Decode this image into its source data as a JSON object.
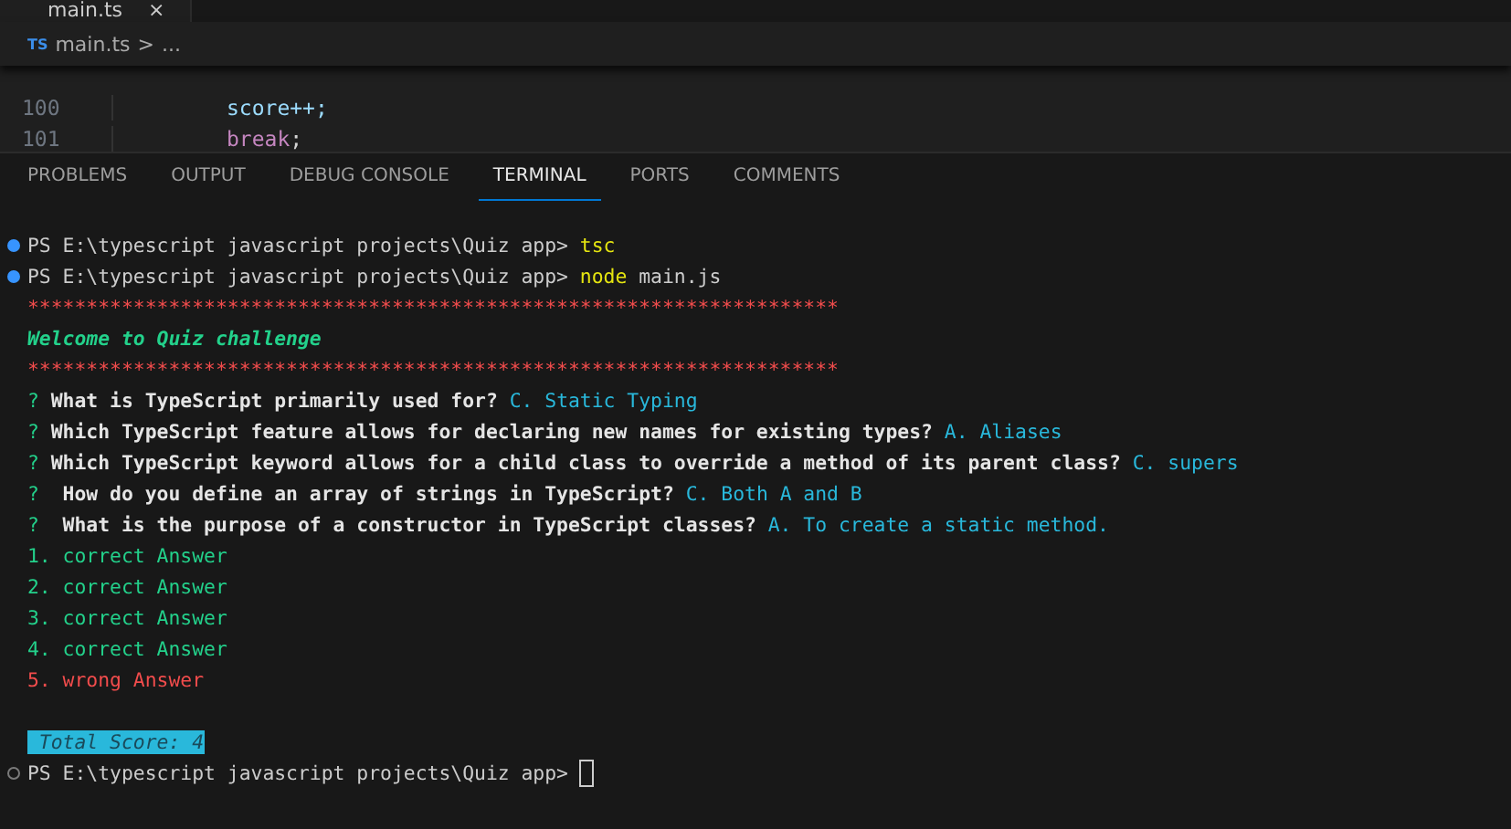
{
  "editor_tab": {
    "label": "main.ts",
    "close": "×"
  },
  "breadcrumb": {
    "badge": "TS",
    "file": "main.ts",
    "separator": ">",
    "rest": "..."
  },
  "code_lines": [
    {
      "number": "100",
      "tokens": [
        {
          "kind": "plain",
          "text": "score++;"
        }
      ]
    },
    {
      "number": "101",
      "tokens": [
        {
          "kind": "keyword",
          "text": "break"
        },
        {
          "kind": "punct",
          "text": ";"
        }
      ]
    }
  ],
  "panel_tabs": [
    {
      "label": "PROBLEMS",
      "selected": false
    },
    {
      "label": "OUTPUT",
      "selected": false
    },
    {
      "label": "DEBUG CONSOLE",
      "selected": false
    },
    {
      "label": "TERMINAL",
      "selected": true
    },
    {
      "label": "PORTS",
      "selected": false
    },
    {
      "label": "COMMENTS",
      "selected": false
    }
  ],
  "terminal_lines": [
    {
      "kind": "prompt",
      "succeeded": true,
      "path": "PS E:\\typescript javascript projects\\Quiz app>",
      "command": "tsc"
    },
    {
      "kind": "prompt",
      "succeeded": true,
      "path": "PS E:\\typescript javascript projects\\Quiz app>",
      "command": "node",
      "args": "main.js"
    },
    {
      "kind": "stars",
      "text": "*********************************************************************"
    },
    {
      "kind": "welcome",
      "text": "Welcome to Quiz challenge"
    },
    {
      "kind": "stars",
      "text": "*********************************************************************"
    },
    {
      "kind": "question",
      "mark": "?",
      "text": "What is TypeScript primarily used for?",
      "answer": "C. Static Typing"
    },
    {
      "kind": "question",
      "mark": "?",
      "text": "Which TypeScript feature allows for declaring new names for existing types?",
      "answer": "A. Aliases"
    },
    {
      "kind": "question",
      "mark": "?",
      "text": "Which TypeScript keyword allows for a child class to override a method of its parent class?",
      "answer": "C. supers"
    },
    {
      "kind": "question",
      "mark": "?",
      "text": " How do you define an array of strings in TypeScript?",
      "answer": "C. Both A and B"
    },
    {
      "kind": "question",
      "mark": "?",
      "text": " What is the purpose of a constructor in TypeScript classes?",
      "answer": "A. To create a static method."
    },
    {
      "kind": "result",
      "number": "1.",
      "text": "correct Answer",
      "correct": true
    },
    {
      "kind": "result",
      "number": "2.",
      "text": "correct Answer",
      "correct": true
    },
    {
      "kind": "result",
      "number": "3.",
      "text": "correct Answer",
      "correct": true
    },
    {
      "kind": "result",
      "number": "4.",
      "text": "correct Answer",
      "correct": true
    },
    {
      "kind": "result",
      "number": "5.",
      "text": "wrong Answer",
      "correct": false
    },
    {
      "kind": "blank"
    },
    {
      "kind": "score",
      "text": "Total Score: 4"
    },
    {
      "kind": "prompt",
      "succeeded": false,
      "path": "PS E:\\typescript javascript projects\\Quiz app>",
      "cursor": true
    }
  ]
}
